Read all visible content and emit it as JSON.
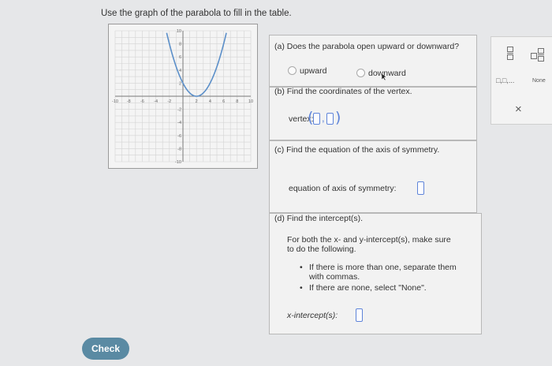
{
  "instruction": "Use the graph of the parabola to fill in the table.",
  "graph": {
    "x_ticks": [
      "-10",
      "-8",
      "-6",
      "-4",
      "-2",
      "2",
      "4",
      "6",
      "8",
      "10"
    ],
    "y_ticks": [
      "10",
      "8",
      "6",
      "4",
      "2",
      "-2",
      "-4",
      "-6",
      "-8",
      "-10"
    ],
    "xlim": [
      -10,
      10
    ],
    "ylim": [
      -10,
      10
    ],
    "curve": "y = 0.5(x-2)^2 + 0",
    "curve_color": "#5b8fc9"
  },
  "part_a": {
    "question": "(a) Does the parabola open upward or downward?",
    "option_1": "upward",
    "option_2": "downward"
  },
  "part_b": {
    "question": "(b) Find the coordinates of the vertex.",
    "label": "vertex:"
  },
  "part_c": {
    "question": "(c) Find the equation of the axis of symmetry.",
    "label": "equation of axis of symmetry:"
  },
  "part_d": {
    "question": "(d) Find the intercept(s).",
    "instruction_1": "For both the x- and y-intercept(s), make sure",
    "instruction_2": "to do the following.",
    "bullet_1a": "If there is more than one, separate them",
    "bullet_1b": "with commas.",
    "bullet_2": "If there are none, select \"None\".",
    "x_label": "x-intercept(s):"
  },
  "palette": {
    "none_label": "None",
    "close_symbol": "×",
    "dots_label": "□,□,..."
  },
  "check_button": "Check",
  "colors": {
    "accent": "#5e84d9",
    "check_button": "#5a8aa3"
  }
}
